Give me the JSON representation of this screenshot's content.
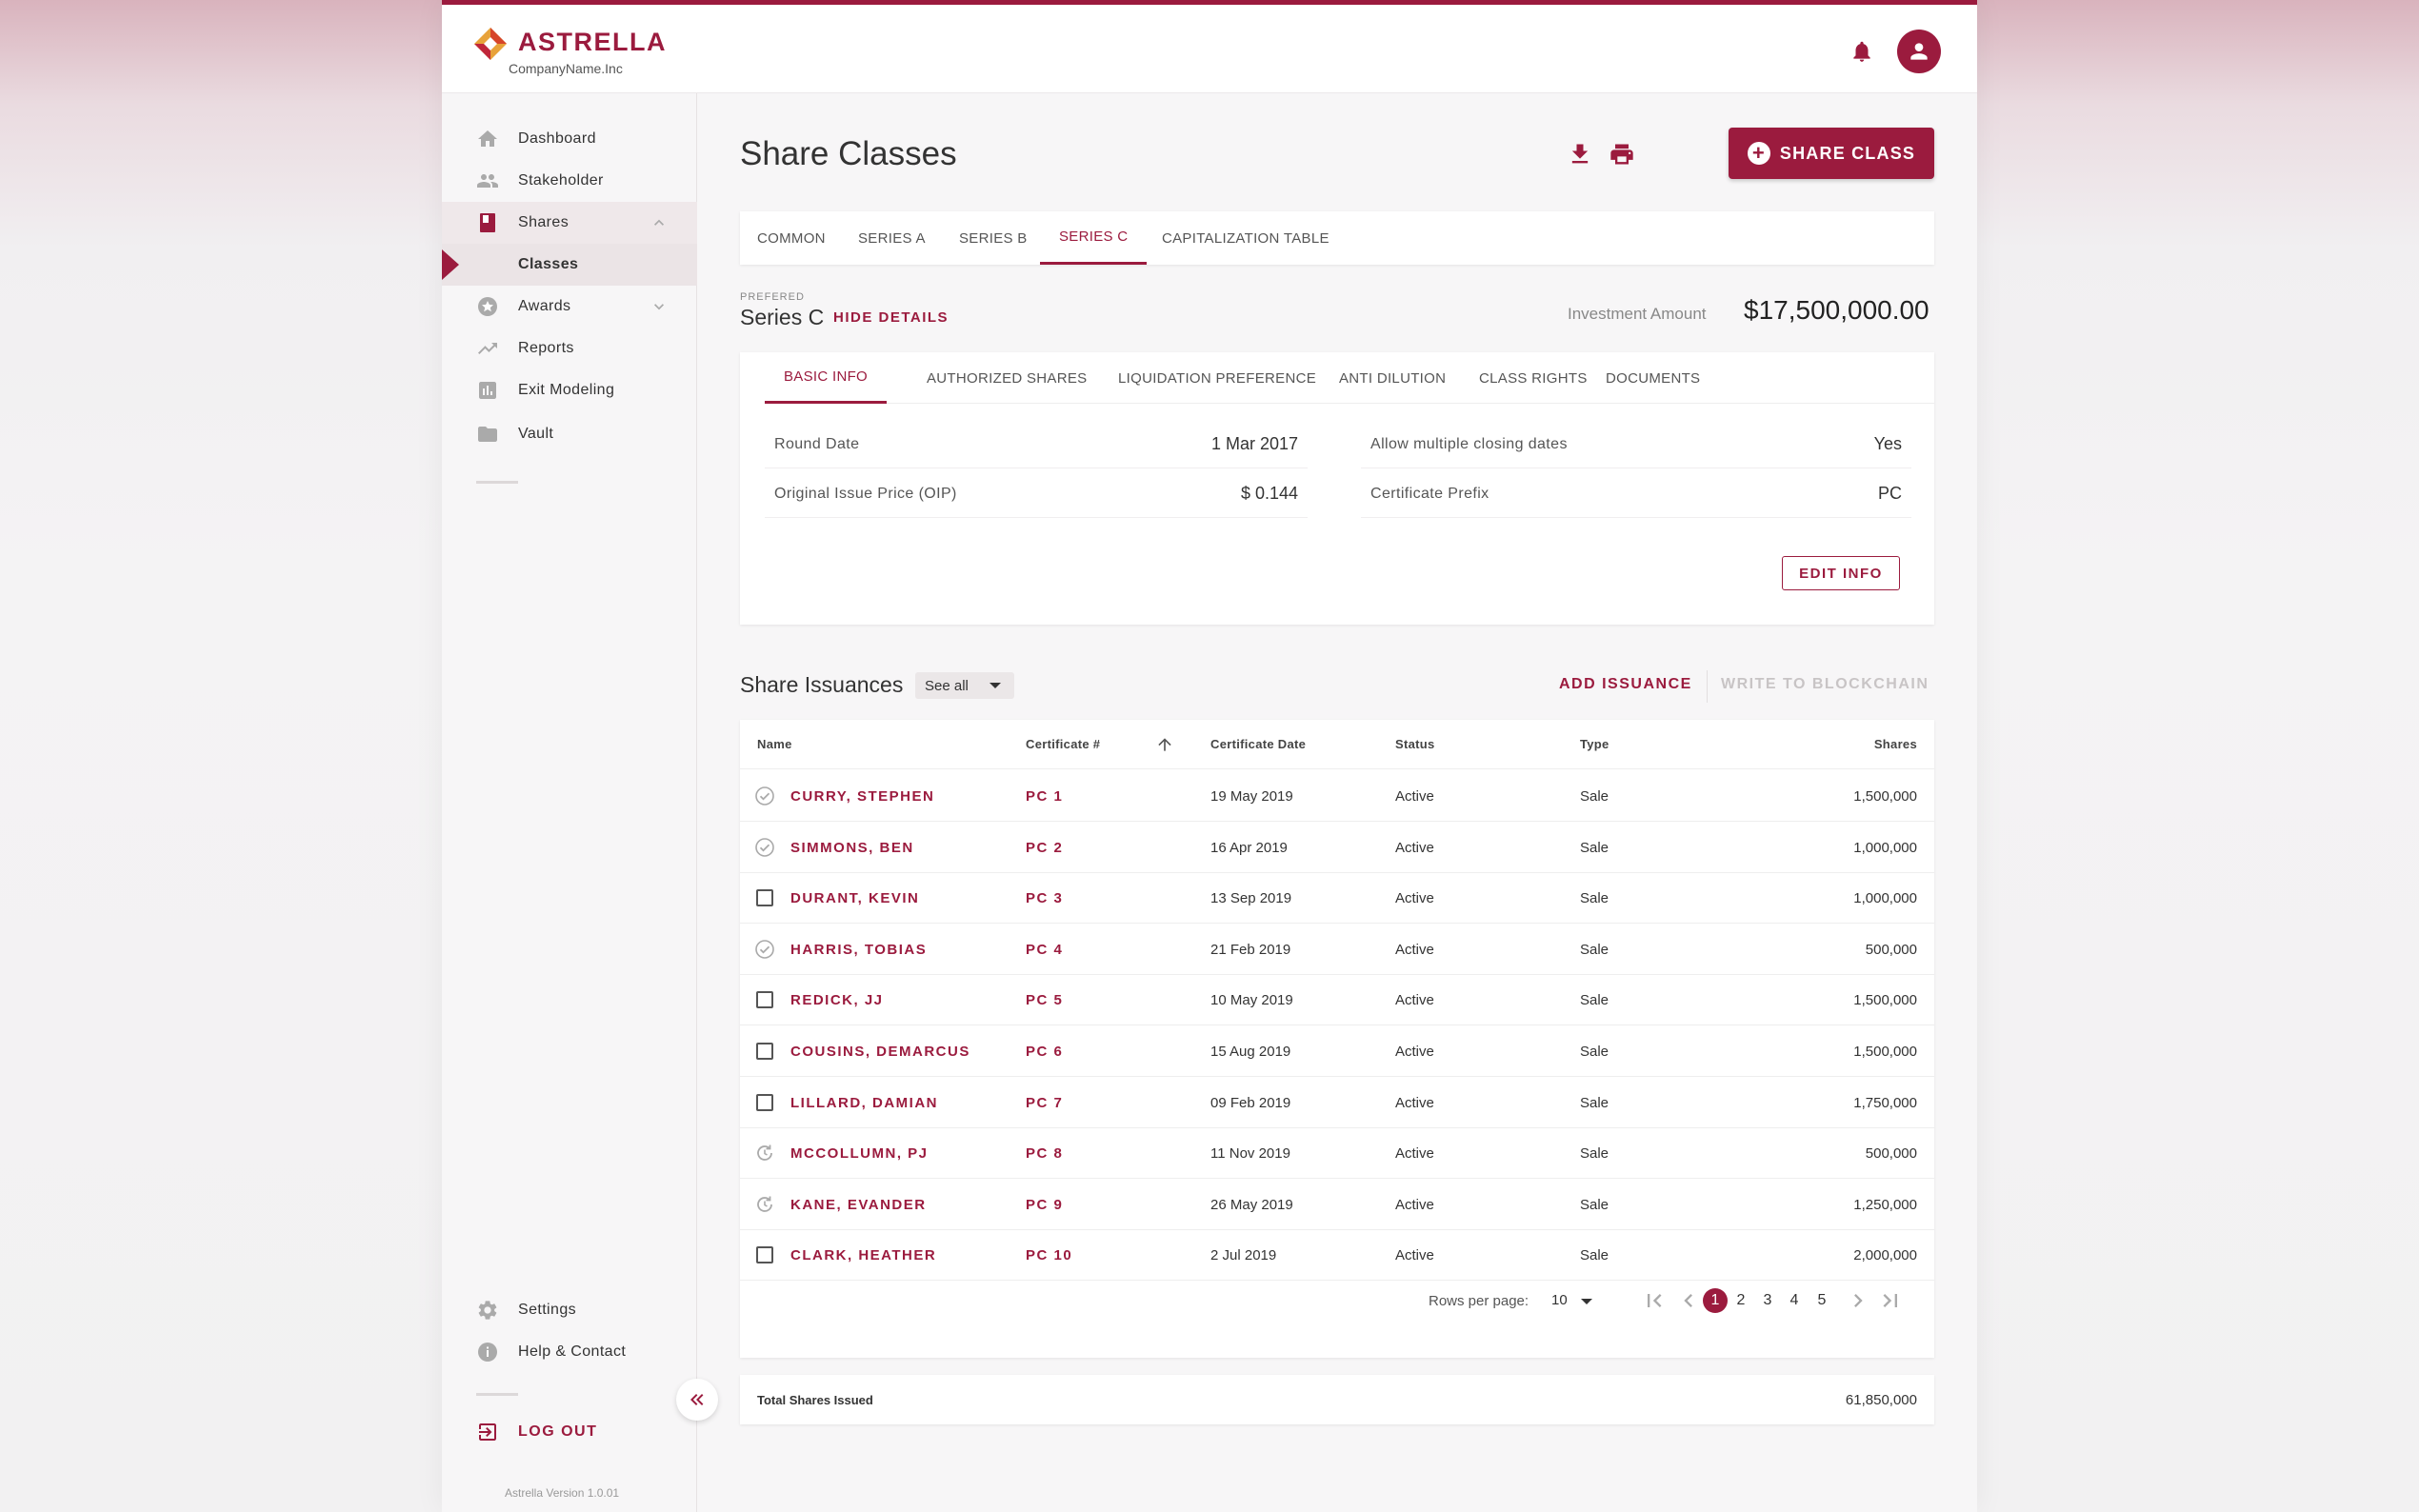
{
  "brand": {
    "name": "ASTRELLA",
    "company": "CompanyName.Inc",
    "accent": "#9b1b3e"
  },
  "header": {
    "notifications_icon": "bell-icon",
    "account_icon": "person-icon"
  },
  "sidebar": {
    "items": [
      {
        "label": "Dashboard",
        "icon": "home-icon"
      },
      {
        "label": "Stakeholder",
        "icon": "people-icon"
      },
      {
        "label": "Shares",
        "icon": "book-icon"
      },
      {
        "label": "Classes"
      },
      {
        "label": "Awards",
        "icon": "star-icon"
      },
      {
        "label": "Reports",
        "icon": "trending-icon"
      },
      {
        "label": "Exit Modeling",
        "icon": "bar-chart-icon"
      },
      {
        "label": "Vault",
        "icon": "folder-icon"
      }
    ],
    "bottom": [
      {
        "label": "Settings",
        "icon": "gear-icon"
      },
      {
        "label": "Help & Contact",
        "icon": "info-icon"
      }
    ],
    "logout": "LOG OUT",
    "version": "Astrella Version 1.0.01"
  },
  "page": {
    "title": "Share Classes",
    "add_button": "SHARE CLASS",
    "tabs": [
      "COMMON",
      "SERIES A",
      "SERIES B",
      "SERIES C",
      "CAPITALIZATION TABLE"
    ],
    "active_tab": "SERIES C"
  },
  "series": {
    "type_label": "PREFERED",
    "name": "Series C",
    "hide_details": "HIDE DETAILS",
    "investment_label": "Investment Amount",
    "investment_value": "$17,500,000.00"
  },
  "details": {
    "tabs": [
      "BASIC INFO",
      "AUTHORIZED SHARES",
      "LIQUIDATION PREFERENCE",
      "ANTI DILUTION",
      "CLASS RIGHTS",
      "DOCUMENTS"
    ],
    "active_tab": "BASIC INFO",
    "fields": [
      {
        "label": "Round Date",
        "value": "1 Mar 2017"
      },
      {
        "label": "Allow multiple closing dates",
        "value": "Yes"
      },
      {
        "label": "Original Issue Price (OIP)",
        "value": "$ 0.144"
      },
      {
        "label": "Certificate Prefix",
        "value": "PC"
      }
    ],
    "edit_button": "EDIT INFO"
  },
  "issuances": {
    "title": "Share Issuances",
    "filter": "See all",
    "add": "ADD ISSUANCE",
    "blockchain": "WRITE TO BLOCKCHAIN",
    "columns": [
      "Name",
      "Certificate #",
      "Certificate Date",
      "Status",
      "Type",
      "Shares"
    ],
    "rows": [
      {
        "state": "verified",
        "name": "CURRY, STEPHEN",
        "cert": "PC 1",
        "date": "19 May 2019",
        "status": "Active",
        "type": "Sale",
        "shares": "1,500,000"
      },
      {
        "state": "verified",
        "name": "SIMMONS, BEN",
        "cert": "PC 2",
        "date": "16 Apr 2019",
        "status": "Active",
        "type": "Sale",
        "shares": "1,000,000"
      },
      {
        "state": "checkbox",
        "name": "DURANT, KEVIN",
        "cert": "PC 3",
        "date": "13 Sep 2019",
        "status": "Active",
        "type": "Sale",
        "shares": "1,000,000"
      },
      {
        "state": "verified",
        "name": "HARRIS, TOBIAS",
        "cert": "PC 4",
        "date": "21 Feb 2019",
        "status": "Active",
        "type": "Sale",
        "shares": "500,000"
      },
      {
        "state": "checkbox",
        "name": "REDICK, JJ",
        "cert": "PC 5",
        "date": "10 May 2019",
        "status": "Active",
        "type": "Sale",
        "shares": "1,500,000"
      },
      {
        "state": "checkbox",
        "name": "COUSINS, DEMARCUS",
        "cert": "PC 6",
        "date": "15 Aug 2019",
        "status": "Active",
        "type": "Sale",
        "shares": "1,500,000"
      },
      {
        "state": "checkbox",
        "name": "LILLARD, DAMIAN",
        "cert": "PC 7",
        "date": "09 Feb 2019",
        "status": "Active",
        "type": "Sale",
        "shares": "1,750,000"
      },
      {
        "state": "pending",
        "name": "MCCOLLUMN, PJ",
        "cert": "PC 8",
        "date": "11 Nov 2019",
        "status": "Active",
        "type": "Sale",
        "shares": "500,000"
      },
      {
        "state": "pending",
        "name": "KANE, EVANDER",
        "cert": "PC 9",
        "date": "26 May 2019",
        "status": "Active",
        "type": "Sale",
        "shares": "1,250,000"
      },
      {
        "state": "checkbox",
        "name": "CLARK, HEATHER",
        "cert": "PC 10",
        "date": "2 Jul 2019",
        "status": "Active",
        "type": "Sale",
        "shares": "2,000,000"
      }
    ],
    "pagination": {
      "rows_per_page_label": "Rows per page:",
      "rows_per_page": "10",
      "pages": [
        "1",
        "2",
        "3",
        "4",
        "5"
      ],
      "current": "1"
    },
    "total_label": "Total Shares Issued",
    "total_value": "61,850,000"
  }
}
